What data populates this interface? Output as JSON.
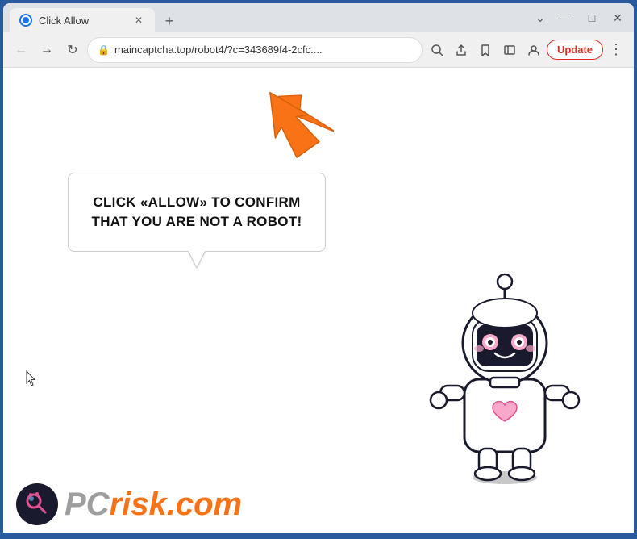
{
  "browser": {
    "tab": {
      "title": "Click Allow",
      "favicon_label": "favicon"
    },
    "new_tab_icon": "+",
    "window_controls": {
      "minimize": "—",
      "maximize": "□",
      "close": "✕"
    },
    "nav": {
      "back_label": "back",
      "forward_label": "forward",
      "reload_label": "reload",
      "url": "maincaptcha.top/robot4/?c=343689f4-2cfc....",
      "lock_icon": "🔒",
      "search_icon": "search",
      "share_icon": "share",
      "star_icon": "star",
      "sidebar_icon": "sidebar",
      "profile_icon": "profile",
      "update_label": "Update",
      "menu_label": "menu"
    }
  },
  "page": {
    "bubble_text": "CLICK «ALLOW» TO CONFIRM THAT YOU ARE NOT A ROBOT!",
    "arrow_direction": "up-left",
    "watermark": {
      "brand": "PC",
      "domain": "risk.com"
    }
  },
  "colors": {
    "accent_orange": "#f97316",
    "browser_blue": "#2a5a9e",
    "update_red": "#d93025"
  }
}
